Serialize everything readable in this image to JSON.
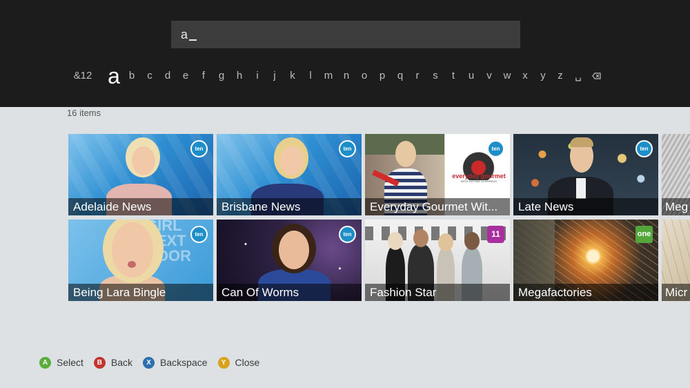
{
  "search": {
    "query": "a"
  },
  "keyboard": {
    "keys": [
      "&12",
      "a",
      "b",
      "c",
      "d",
      "e",
      "f",
      "g",
      "h",
      "i",
      "j",
      "k",
      "l",
      "m",
      "n",
      "o",
      "p",
      "q",
      "r",
      "s",
      "t",
      "u",
      "v",
      "w",
      "x",
      "y",
      "z",
      "␣"
    ],
    "selected_index": 1
  },
  "results": {
    "count_label": "16 items",
    "tiles": [
      {
        "title": "Adelaide News",
        "channel_badge": "ten"
      },
      {
        "title": "Brisbane News",
        "channel_badge": "ten"
      },
      {
        "title": "Everyday Gourmet Wit...",
        "channel_badge": "ten",
        "logo_text": "everyday gourmet",
        "logo_subtext": "WITH JUSTINE SCHOFIELD"
      },
      {
        "title": "Late News",
        "channel_badge": "ten"
      },
      {
        "title": "Meg"
      },
      {
        "title": "Being Lara Bingle",
        "channel_badge": "ten",
        "background_text": "GIRL NEXT DOOR"
      },
      {
        "title": "Can Of Worms",
        "channel_badge": "ten"
      },
      {
        "title": "Fashion Star",
        "channel_badge": "11"
      },
      {
        "title": "Megafactories",
        "channel_badge": "one"
      },
      {
        "title": "Micr"
      }
    ]
  },
  "footer": {
    "hints": [
      {
        "button": "A",
        "label": "Select",
        "color": "#5cae3c"
      },
      {
        "button": "B",
        "label": "Back",
        "color": "#c3342d"
      },
      {
        "button": "X",
        "label": "Backspace",
        "color": "#2e6fb0"
      },
      {
        "button": "Y",
        "label": "Close",
        "color": "#d9a21b"
      }
    ]
  },
  "colors": {
    "top_panel": "#1c1c1c",
    "background": "#dde1e4",
    "ten_badge": "#1e8ec8"
  }
}
